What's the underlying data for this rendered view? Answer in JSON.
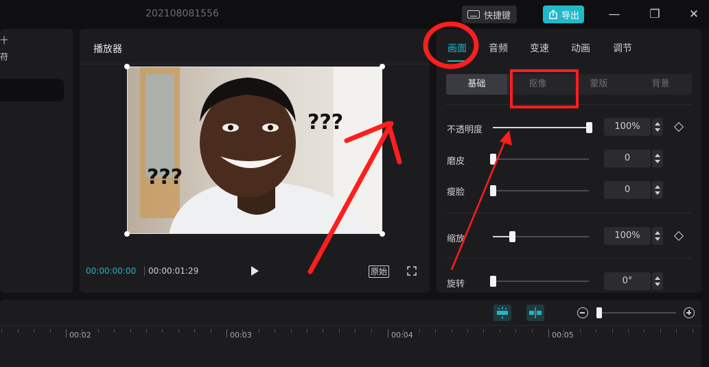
{
  "titlebar": {
    "project_name": "202108081556",
    "shortcut_label": "快捷键",
    "export_label": "导出",
    "minimize_glyph": "—",
    "maximize_glyph": "❐",
    "close_glyph": "✕"
  },
  "left_panel": {
    "fragment_1": "十",
    "fragment_2": "苻"
  },
  "player": {
    "title": "播放器",
    "preview_text": [
      "???",
      "???"
    ],
    "current_time": "00:00:00:00",
    "total_time": "00:00:01:29",
    "original_label": "原始"
  },
  "properties": {
    "tabs": [
      {
        "label": "画面",
        "active": true
      },
      {
        "label": "音频",
        "active": false
      },
      {
        "label": "变速",
        "active": false
      },
      {
        "label": "动画",
        "active": false
      },
      {
        "label": "调节",
        "active": false
      }
    ],
    "subtabs": [
      {
        "label": "基础",
        "active": true
      },
      {
        "label": "抠像",
        "active": false
      },
      {
        "label": "蒙版",
        "active": false
      },
      {
        "label": "背景",
        "active": false
      }
    ],
    "rows": [
      {
        "label": "不透明度",
        "value": "100%",
        "level": 1.0,
        "keyframe": true
      },
      {
        "label": "磨皮",
        "value": "0",
        "level": 0.0,
        "keyframe": false
      },
      {
        "label": "瘦脸",
        "value": "0",
        "level": 0.0,
        "keyframe": false
      },
      {
        "label": "缩放",
        "value": "100%",
        "level": 0.2,
        "keyframe": true
      },
      {
        "label": "旋转",
        "value": "0°",
        "level": 0.0,
        "keyframe": false
      }
    ]
  },
  "timeline": {
    "ruler_labels": [
      "00:02",
      "00:03",
      "00:04",
      "00:05"
    ]
  },
  "colors": {
    "accent": "#27b3c2",
    "export_button": "#20b9c9",
    "annotation": "#ff1e1e"
  },
  "icons": [
    "keyboard-icon",
    "export-icon",
    "minimize-icon",
    "maximize-icon",
    "close-icon",
    "play-icon",
    "fullscreen-icon",
    "keyframe-icon",
    "zoom-out-icon",
    "zoom-in-icon"
  ]
}
